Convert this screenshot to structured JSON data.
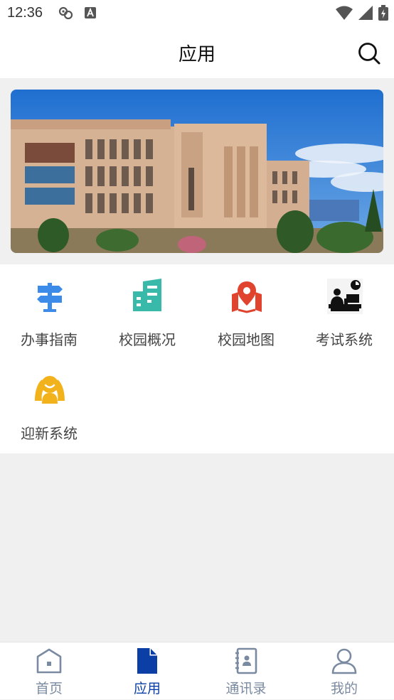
{
  "status_bar": {
    "time": "12:36"
  },
  "header": {
    "title": "应用"
  },
  "apps": [
    {
      "label": "办事指南",
      "icon": "signpost-icon",
      "color": "#3d8be8"
    },
    {
      "label": "校园概况",
      "icon": "building-icon",
      "color": "#39b9a9"
    },
    {
      "label": "校园地图",
      "icon": "map-pin-icon",
      "color": "#e0442e"
    },
    {
      "label": "考试系统",
      "icon": "exam-desk-icon",
      "color": "#111111"
    },
    {
      "label": "迎新系统",
      "icon": "welcome-person-icon",
      "color": "#f2b21b"
    }
  ],
  "tabs": [
    {
      "label": "首页",
      "icon": "home-icon",
      "active": false
    },
    {
      "label": "应用",
      "icon": "document-icon",
      "active": true
    },
    {
      "label": "通讯录",
      "icon": "contacts-icon",
      "active": false
    },
    {
      "label": "我的",
      "icon": "profile-icon",
      "active": false
    }
  ],
  "colors": {
    "accent": "#0b3fa6",
    "inactive_tab": "#7a8aa0"
  }
}
